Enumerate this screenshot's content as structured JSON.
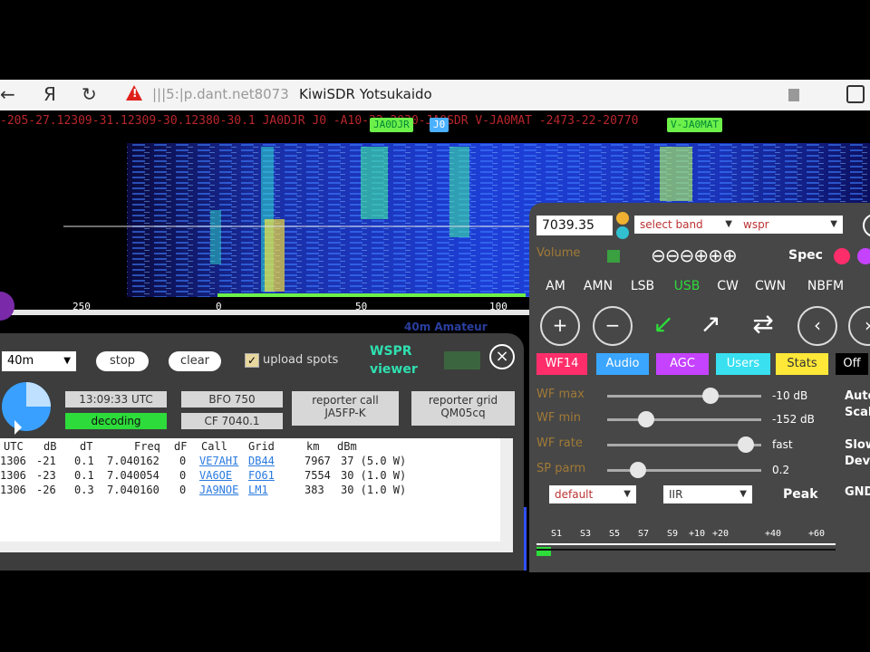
{
  "browser": {
    "back_glyph": "←",
    "ya_glyph": "Я",
    "reload_glyph": "↻",
    "warning_glyph": "!",
    "url": "|||5:|p.dant.net8073",
    "tab_title": "KiwiSDR Yotsukaido"
  },
  "spots_row": {
    "text": "-205-27.12309-31.12309-30.12380-30.1  JA0DJR  J0   -A10-32-2030-JA0SDR       V-JA0MAT  -2473-22-20770",
    "tags": [
      "JA0DJR",
      "J0",
      "V-JA0MAT"
    ]
  },
  "scale": {
    "labels": [
      "250",
      "0",
      "50",
      "100"
    ]
  },
  "band_label": "40m Amateur",
  "wspr": {
    "band_select": "40m",
    "stop_label": "stop",
    "clear_label": "clear",
    "upload_label": "upload spots",
    "title_line1": "WSPR",
    "title_line2": "viewer",
    "close_glyph": "×",
    "utc_time": "13:09:33 UTC",
    "status": "decoding",
    "bfo": "BFO 750",
    "cf": "CF 7040.1",
    "reporter_call_label": "reporter call",
    "reporter_call_value": "JA5FP-K",
    "reporter_grid_label": "reporter grid",
    "reporter_grid_value": "QM05cq",
    "columns": [
      "UTC",
      "dB",
      "dT",
      "Freq",
      "dF",
      "Call",
      "Grid",
      "km",
      "dBm"
    ],
    "rows": [
      [
        "1306",
        "-21",
        "0.1",
        "7.040162",
        "0",
        "VE7AHI",
        "DB44",
        "7967",
        "37 (5.0 W)"
      ],
      [
        "1306",
        "-23",
        "0.1",
        "7.040054",
        "0",
        "VA6OE",
        "FO61",
        "7554",
        "30 (1.0 W)"
      ],
      [
        "1306",
        "-26",
        "0.3",
        "7.040160",
        "0",
        "JA9NOE",
        "LM1",
        "383",
        "30 (1.0 W)"
      ]
    ]
  },
  "ctrl": {
    "freq": "7039.35",
    "band_select": "select band",
    "ext_select": "wspr",
    "volume_label": "Volume",
    "zoom_glyphs": [
      "⊖",
      "⊖",
      "⊖",
      "⊕",
      "⊕",
      "⊕"
    ],
    "spec_label": "Spec",
    "modes": [
      "AM",
      "AMN",
      "LSB",
      "USB",
      "CW",
      "CWN",
      "NBFM"
    ],
    "icon_glyphs": [
      "+",
      "−",
      "↙",
      "↗",
      "⇄",
      "‹",
      "›"
    ],
    "buttons": [
      "WF14",
      "Audio",
      "AGC",
      "Users",
      "Stats",
      "Off"
    ],
    "button_colors": [
      "#ff2e6b",
      "#3aa6ff",
      "#c542ff",
      "#38e0f0",
      "#ffe838",
      "#000000"
    ],
    "sliders": [
      {
        "label": "WF max",
        "value": "-10 dB",
        "level": 0.67
      },
      {
        "label": "WF min",
        "value": "-152 dB",
        "level": 0.25
      },
      {
        "label": "WF rate",
        "value": "fast",
        "level": 0.9
      },
      {
        "label": "SP parm",
        "value": "0.2",
        "level": 0.2
      }
    ],
    "default_select": "default",
    "iir_select": "IIR",
    "peak_label": "Peak",
    "side_labels": [
      "Auto",
      "Scale",
      "Slow",
      "Dev",
      "GND"
    ],
    "s_ticks": [
      "S1",
      "S3",
      "S5",
      "S7",
      "S9",
      "+10",
      "+20",
      "+40",
      "+60"
    ]
  }
}
